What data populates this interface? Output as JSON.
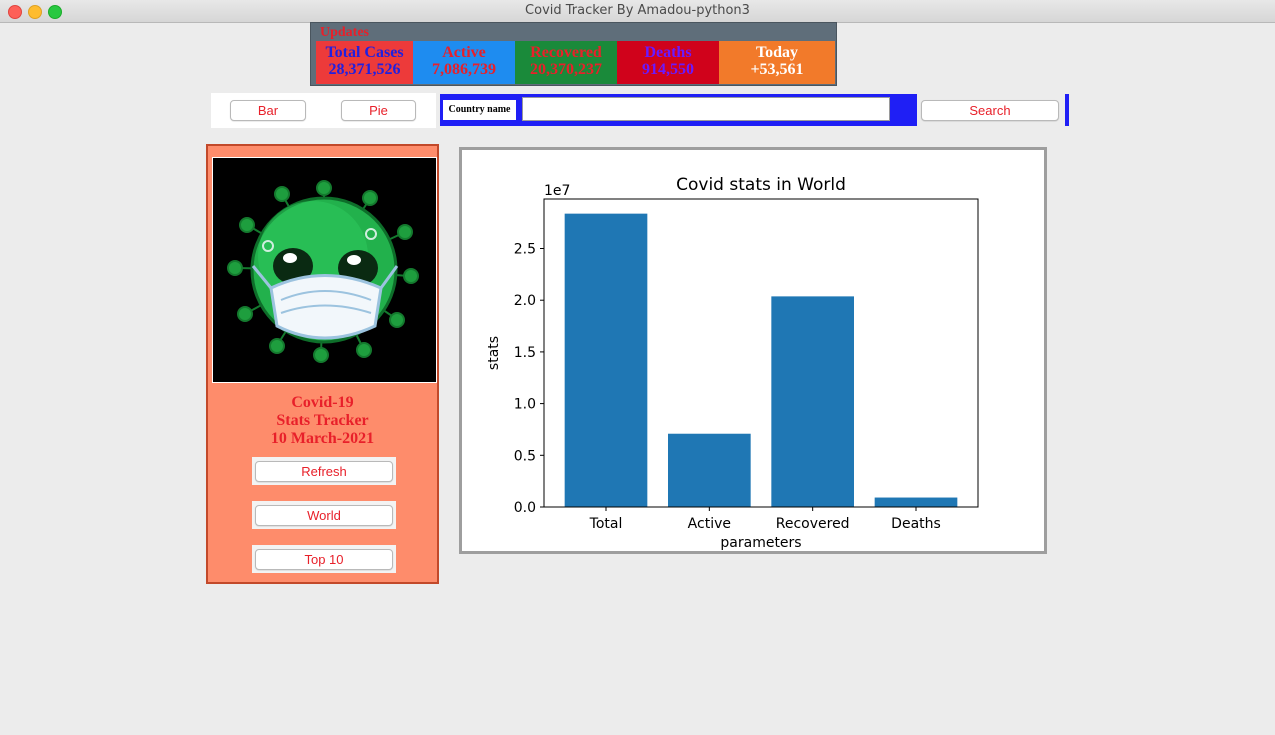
{
  "window": {
    "title": "Covid Tracker By Amadou-python3"
  },
  "updates": {
    "label": "Updates",
    "cells": [
      {
        "label": "Total Cases",
        "value": "28,371,526"
      },
      {
        "label": "Active",
        "value": "7,086,739"
      },
      {
        "label": "Recovered",
        "value": "20,370,237"
      },
      {
        "label": "Deaths",
        "value": "914,550"
      },
      {
        "label": "Today",
        "value": "+53,561"
      }
    ]
  },
  "toolbar": {
    "bar_label": "Bar",
    "pie_label": "Pie"
  },
  "search": {
    "country_label": "Country name",
    "value": "",
    "button_label": "Search"
  },
  "sidebar": {
    "line1": "Covid-19",
    "line2": "Stats Tracker",
    "line3": "10 March-2021",
    "refresh_label": "Refresh",
    "world_label": "World",
    "top10_label": "Top 10"
  },
  "colors": {
    "bar": "#1f77b4",
    "accent_red": "#e8202a",
    "panel": "#fe8c6b",
    "search_bg": "#1f1ff5"
  },
  "chart_data": {
    "type": "bar",
    "title": "Covid stats in World",
    "xlabel": "parameters",
    "ylabel": "stats",
    "offset_text": "1e7",
    "categories": [
      "Total",
      "Active",
      "Recovered",
      "Deaths"
    ],
    "values": [
      28371526,
      7086739,
      20370237,
      914550
    ],
    "ylim": [
      0,
      29788000
    ],
    "yticks": [
      0,
      5000000,
      10000000,
      15000000,
      20000000,
      25000000
    ],
    "ytick_labels": [
      "0.0",
      "0.5",
      "1.0",
      "1.5",
      "2.0",
      "2.5"
    ],
    "grid": false
  }
}
